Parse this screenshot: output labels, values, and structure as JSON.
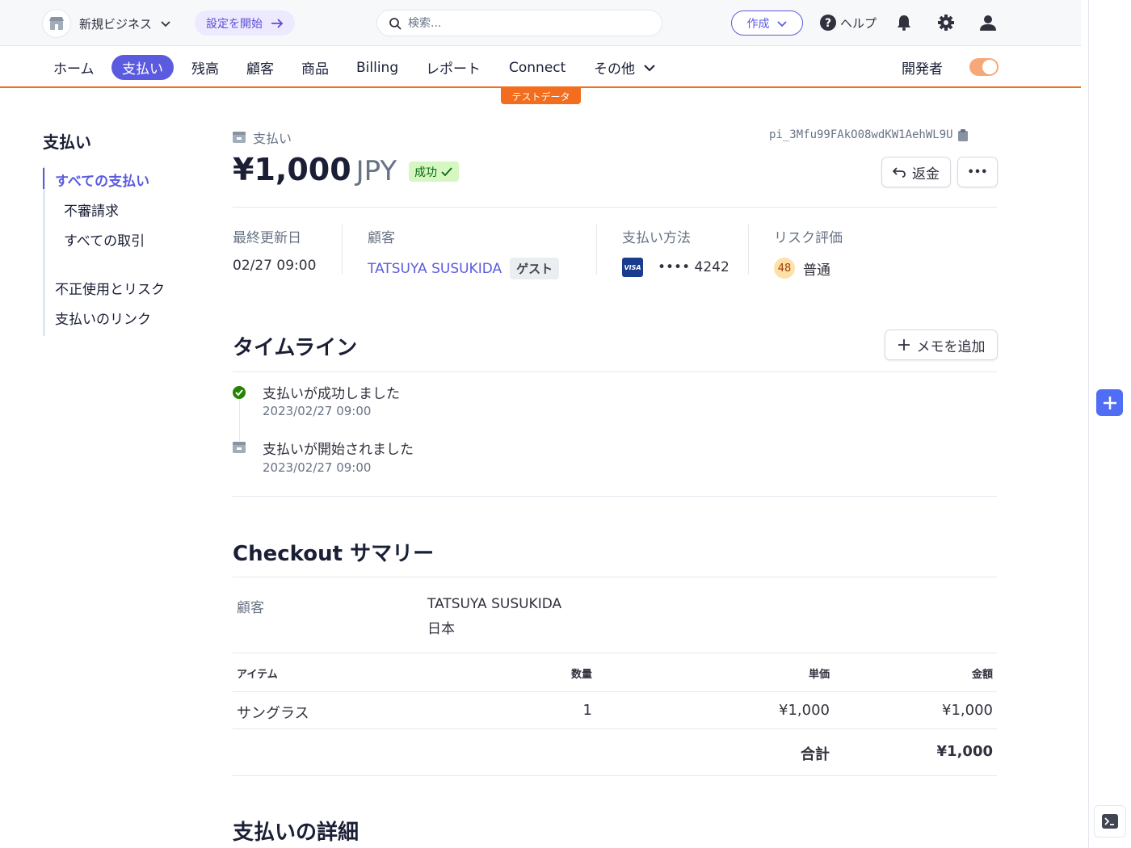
{
  "topbar": {
    "business_name": "新規ビジネス",
    "setup_label": "設定を開始",
    "search_placeholder": "検索...",
    "create_label": "作成",
    "help_label": "ヘルプ"
  },
  "nav": {
    "items": [
      "ホーム",
      "支払い",
      "残高",
      "顧客",
      "商品",
      "Billing",
      "レポート",
      "Connect",
      "その他"
    ],
    "active": "支払い",
    "developer_label": "開発者",
    "test_badge": "テストデータ"
  },
  "sidebar": {
    "title": "支払い",
    "items": [
      "すべての支払い",
      "不審請求",
      "すべての取引",
      "不正使用とリスク",
      "支払いのリンク"
    ]
  },
  "payment": {
    "crumb": "支払い",
    "id": "pi_3Mfu99FAkO08wdKW1AehWL9U",
    "amount": "¥1,000",
    "currency": "JPY",
    "status": "成功",
    "refund_label": "返金",
    "more_label": "•••"
  },
  "meta": {
    "updated_label": "最終更新日",
    "updated_value": "02/27 09:00",
    "customer_label": "顧客",
    "customer_value": "TATSUYA SUSUKIDA",
    "guest_tag": "ゲスト",
    "method_label": "支払い方法",
    "card_brand": "VISA",
    "card_last4": "•••• 4242",
    "risk_label": "リスク評価",
    "risk_score": "48",
    "risk_level": "普通"
  },
  "timeline": {
    "title": "タイムライン",
    "add_note_label": "メモを追加",
    "events": [
      {
        "title": "支払いが成功しました",
        "time": "2023/02/27 09:00"
      },
      {
        "title": "支払いが開始されました",
        "time": "2023/02/27 09:00"
      }
    ]
  },
  "checkout": {
    "title": "Checkout サマリー",
    "customer_label": "顧客",
    "customer_name": "TATSUYA SUSUKIDA",
    "customer_country": "日本",
    "columns": [
      "アイテム",
      "数量",
      "単価",
      "金額"
    ],
    "rows": [
      {
        "item": "サングラス",
        "qty": "1",
        "unit": "¥1,000",
        "amount": "¥1,000"
      }
    ],
    "total_label": "合計",
    "total_value": "¥1,000"
  },
  "details": {
    "title": "支払いの詳細"
  },
  "colors": {
    "accent": "#5b5be0",
    "test_orange": "#f26d1d",
    "success_bg": "#d7f7c2"
  }
}
